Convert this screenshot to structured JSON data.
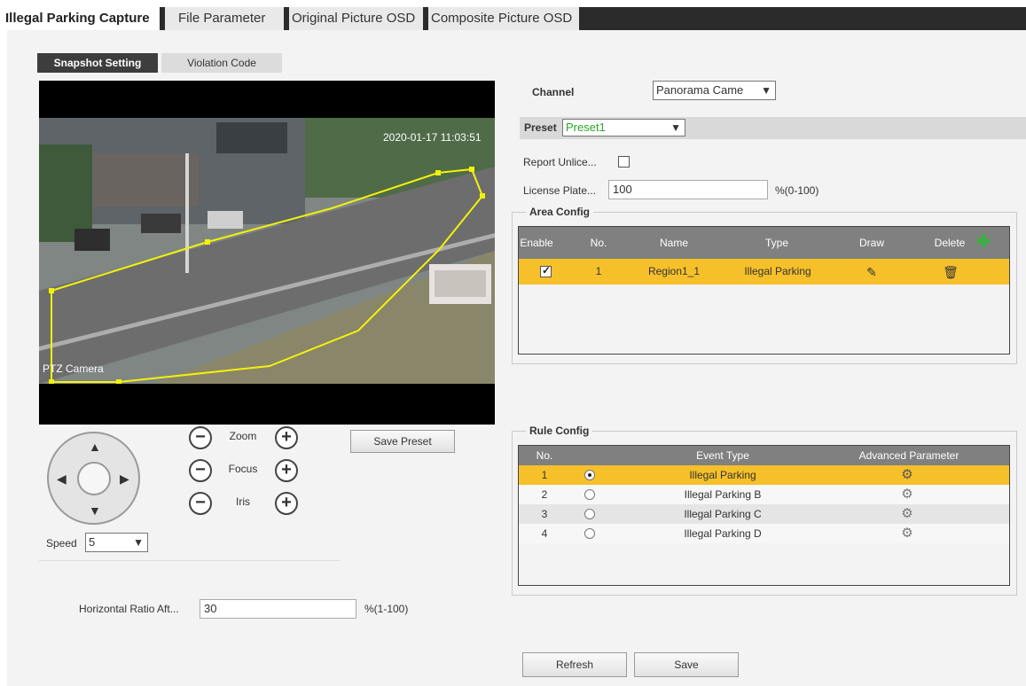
{
  "top_tabs": [
    {
      "label": "Illegal Parking Capture",
      "active": true
    },
    {
      "label": "File Parameter",
      "active": false
    },
    {
      "label": "Original Picture OSD",
      "active": false
    },
    {
      "label": "Composite Picture OSD",
      "active": false
    }
  ],
  "sub_tabs": [
    {
      "label": "Snapshot Setting",
      "active": true
    },
    {
      "label": "Violation Code",
      "active": false
    }
  ],
  "video": {
    "timestamp": "2020-01-17 11:03:51",
    "camera_label": "PTZ Camera"
  },
  "ptz": {
    "zoom_label": "Zoom",
    "focus_label": "Focus",
    "iris_label": "Iris",
    "minus_symbol": "−",
    "plus_symbol": "+",
    "save_preset_label": "Save Preset",
    "speed_label": "Speed",
    "speed_value": "5"
  },
  "horizontal_ratio": {
    "label": "Horizontal Ratio Aft...",
    "value": "30",
    "unit": "%(1-100)"
  },
  "channel": {
    "label": "Channel",
    "value": "Panorama Came"
  },
  "preset": {
    "label": "Preset",
    "value": "Preset1"
  },
  "report_unlicensed": {
    "label": "Report Unlice..."
  },
  "license_plate": {
    "label": "License Plate...",
    "value": "100",
    "unit": "%(0-100)"
  },
  "area_config": {
    "title": "Area Config",
    "headers": {
      "enable": "Enable",
      "no": "No.",
      "name": "Name",
      "type": "Type",
      "draw": "Draw",
      "delete": "Delete"
    },
    "rows": [
      {
        "no": "1",
        "name": "Region1_1",
        "type": "Illegal Parking"
      }
    ]
  },
  "rule_config": {
    "title": "Rule Config",
    "headers": {
      "no": "No.",
      "event_type": "Event Type",
      "advanced": "Advanced Parameter"
    },
    "rows": [
      {
        "no": "1",
        "event_type": "Illegal Parking"
      },
      {
        "no": "2",
        "event_type": "Illegal Parking B"
      },
      {
        "no": "3",
        "event_type": "Illegal Parking C"
      },
      {
        "no": "4",
        "event_type": "Illegal Parking D"
      }
    ]
  },
  "actions": {
    "refresh_label": "Refresh",
    "save_label": "Save"
  },
  "colors": {
    "selected_row": "#f5c02a",
    "add_icon": "#3cb043",
    "preset_text": "#2aa52a",
    "region_outline": "#f2f20a"
  }
}
